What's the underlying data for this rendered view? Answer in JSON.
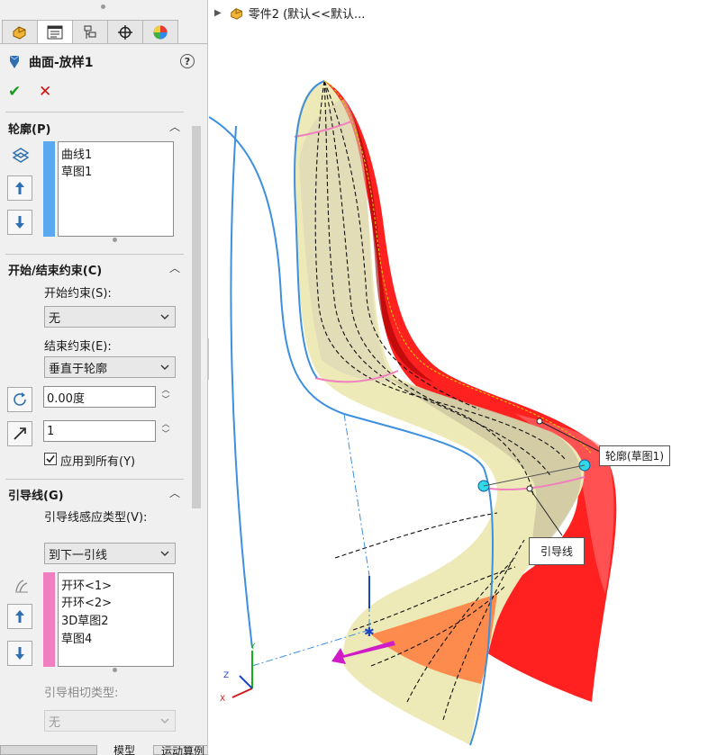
{
  "tabs": [
    {
      "name": "feature-manager",
      "icon": "part-icon"
    },
    {
      "name": "property-manager",
      "icon": "property-icon"
    },
    {
      "name": "configuration-manager",
      "icon": "config-icon"
    },
    {
      "name": "dimxpert-manager",
      "icon": "crosshair-icon"
    },
    {
      "name": "display-manager",
      "icon": "appearance-icon"
    }
  ],
  "feature": {
    "title": "曲面-放样1",
    "help": "?",
    "ok": "✔",
    "cancel": "✕"
  },
  "profiles": {
    "title": "轮廓(P)",
    "items": [
      "曲线1",
      "草图1"
    ],
    "stripe_color": "#5aa8f0"
  },
  "constraints": {
    "title": "开始/结束约束(C)",
    "start_label": "开始约束(S):",
    "start_value": "无",
    "end_label": "结束约束(E):",
    "end_value": "垂直于轮廓",
    "angle_value": "0.00度",
    "length_value": "1",
    "apply_all_label": "应用到所有(Y)"
  },
  "guides": {
    "title": "引导线(G)",
    "influence_label": "引导线感应类型(V):",
    "influence_value": "到下一引线",
    "items": [
      "开环<1>",
      "开环<2>",
      "3D草图2",
      "草图4"
    ],
    "stripe_color": "#f07fbf",
    "tangency_label": "引导相切类型:",
    "tangency_value": "无"
  },
  "bottom_tabs": [
    "模型",
    "运动算例"
  ],
  "viewport": {
    "crumb": "零件2  (默认<<默认...",
    "callout_profile": "轮廓(草图1)",
    "callout_guide": "引导线",
    "surface_color": "#ff1a1a",
    "face_color": "#eeeab8"
  }
}
